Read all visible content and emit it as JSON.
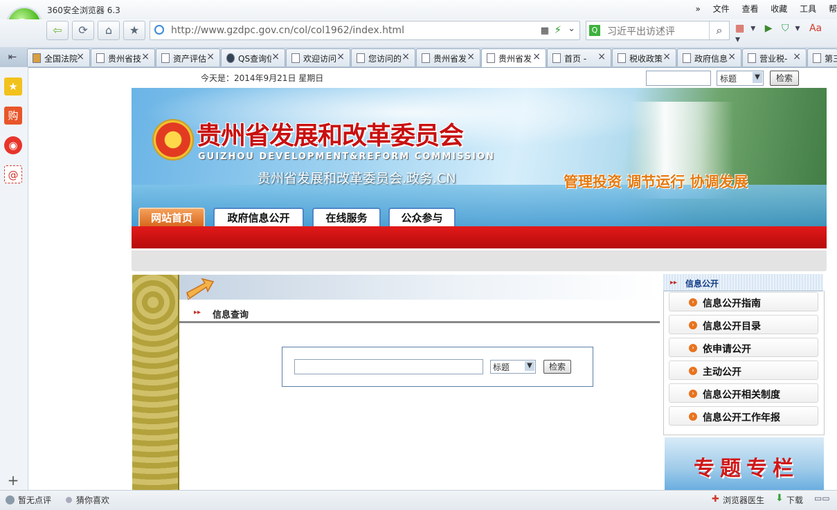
{
  "browser": {
    "title": "360安全浏览器 6.3",
    "menu": [
      "文件",
      "查看",
      "收藏",
      "工具",
      "帮"
    ],
    "menu_arrows": "»",
    "url": "http://www.gzdpc.gov.cn/col/col1962/index.html",
    "search_text": "习近平出访述评",
    "tabs": [
      {
        "label": "全国法院"
      },
      {
        "label": "贵州省技"
      },
      {
        "label": "资产评估"
      },
      {
        "label": "QS查询信"
      },
      {
        "label": "欢迎访问"
      },
      {
        "label": "您访问的"
      },
      {
        "label": "贵州省发"
      },
      {
        "label": "贵州省发"
      },
      {
        "label": "首页 -"
      },
      {
        "label": "税收政策"
      },
      {
        "label": "政府信息"
      },
      {
        "label": "营业税-"
      },
      {
        "label": "第三"
      }
    ],
    "status_left": "暂无点评",
    "status_mid": "猜你喜欢",
    "status_doctor": "浏览器医生",
    "status_download": "下载"
  },
  "page": {
    "date_text": "今天是：2014年9月21日  星期日",
    "top_search": {
      "select": "标题",
      "button": "检索"
    },
    "banner": {
      "org_cn": "贵州省发展和改革委员会",
      "org_en": "GUIZHOU DEVELOPMENT&REFORM COMMISSION",
      "domain": "贵州省发展和改革委员会.政务.CN",
      "slogan": "管理投资  调节运行  协调发展"
    },
    "nav": [
      "网站首页",
      "政府信息公开",
      "在线服务",
      "公众参与"
    ],
    "section_title": "信息查询",
    "query": {
      "select": "标题",
      "button": "检索"
    },
    "right_panel": {
      "title": "信息公开",
      "items": [
        "信息公开指南",
        "信息公开目录",
        "依申请公开",
        "主动公开",
        "信息公开相关制度",
        "信息公开工作年报"
      ]
    },
    "special_banner": "专题专栏"
  }
}
